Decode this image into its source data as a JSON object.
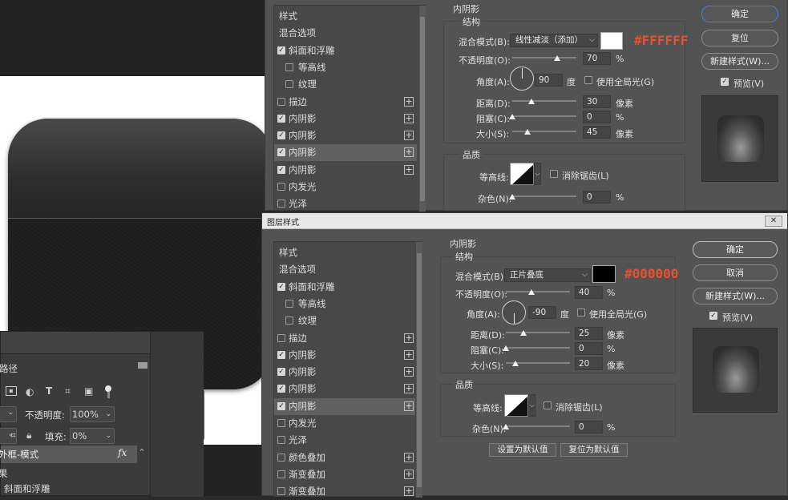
{
  "layers_panel": {
    "tab_label": "路径",
    "opacity_label": "不透明度:",
    "opacity_value": "100%",
    "fill_label": "填充:",
    "fill_value": "0%",
    "layer_name": "外框-模式",
    "fx_label": "fx",
    "effects_label": "果",
    "bevel_label": "斜面和浮雕"
  },
  "dialog_top": {
    "section_title": "内阴影",
    "structure_label": "结构",
    "blend_mode_label": "混合模式(B):",
    "blend_mode_value": "线性减淡（添加）",
    "blend_color": "#FFFFFF",
    "color_annotation": "#FFFFFF",
    "opacity_label": "不透明度(O):",
    "opacity_value": "70",
    "angle_label": "角度(A):",
    "angle_value": "90",
    "degree_unit": "度",
    "global_light_label": "使用全局光(G)",
    "distance_label": "距离(D):",
    "distance_value": "30",
    "choke_label": "阻塞(C):",
    "choke_value": "0",
    "size_label": "大小(S):",
    "size_value": "45",
    "pixel_unit": "像素",
    "percent_unit": "%",
    "quality_label": "品质",
    "contour_label": "等高线:",
    "anti_alias_label": "消除锯齿(L)",
    "noise_label": "杂色(N):",
    "noise_value": "0",
    "ok_label": "确定",
    "reset_label": "复位",
    "new_style_label": "新建样式(W)...",
    "preview_label": "预览(V)"
  },
  "dialog_bottom": {
    "window_title": "图层样式",
    "section_title": "内阴影",
    "structure_label": "结构",
    "blend_mode_label": "混合模式(B):",
    "blend_mode_value": "正片叠底",
    "blend_color": "#000000",
    "color_annotation": "#000000",
    "opacity_label": "不透明度(O):",
    "opacity_value": "40",
    "angle_label": "角度(A):",
    "angle_value": "-90",
    "degree_unit": "度",
    "global_light_label": "使用全局光(G)",
    "distance_label": "距离(D):",
    "distance_value": "25",
    "choke_label": "阻塞(C):",
    "choke_value": "0",
    "size_label": "大小(S):",
    "size_value": "20",
    "pixel_unit": "像素",
    "percent_unit": "%",
    "quality_label": "品质",
    "contour_label": "等高线:",
    "anti_alias_label": "消除锯齿(L)",
    "noise_label": "杂色(N):",
    "noise_value": "0",
    "set_default_label": "设置为默认值",
    "reset_default_label": "复位为默认值",
    "ok_label": "确定",
    "cancel_label": "取消",
    "new_style_label": "新建样式(W)...",
    "preview_label": "预览(V)"
  },
  "style_list_top": [
    {
      "label": "样式",
      "check": null,
      "plus": false,
      "sub": false,
      "hl": false
    },
    {
      "label": "混合选项",
      "check": null,
      "plus": false,
      "sub": false,
      "hl": false
    },
    {
      "label": "斜面和浮雕",
      "check": true,
      "plus": false,
      "sub": false,
      "hl": false
    },
    {
      "label": "等高线",
      "check": false,
      "plus": false,
      "sub": true,
      "hl": false
    },
    {
      "label": "纹理",
      "check": false,
      "plus": false,
      "sub": true,
      "hl": false
    },
    {
      "label": "描边",
      "check": false,
      "plus": true,
      "sub": false,
      "hl": false
    },
    {
      "label": "内阴影",
      "check": true,
      "plus": true,
      "sub": false,
      "hl": false
    },
    {
      "label": "内阴影",
      "check": true,
      "plus": true,
      "sub": false,
      "hl": false
    },
    {
      "label": "内阴影",
      "check": true,
      "plus": true,
      "sub": false,
      "hl": true
    },
    {
      "label": "内阴影",
      "check": true,
      "plus": true,
      "sub": false,
      "hl": false
    },
    {
      "label": "内发光",
      "check": false,
      "plus": false,
      "sub": false,
      "hl": false
    },
    {
      "label": "光泽",
      "check": false,
      "plus": false,
      "sub": false,
      "hl": false
    }
  ],
  "style_list_bottom": [
    {
      "label": "样式",
      "check": null,
      "plus": false,
      "sub": false,
      "hl": false
    },
    {
      "label": "混合选项",
      "check": null,
      "plus": false,
      "sub": false,
      "hl": false
    },
    {
      "label": "斜面和浮雕",
      "check": true,
      "plus": false,
      "sub": false,
      "hl": false
    },
    {
      "label": "等高线",
      "check": false,
      "plus": false,
      "sub": true,
      "hl": false
    },
    {
      "label": "纹理",
      "check": false,
      "plus": false,
      "sub": true,
      "hl": false
    },
    {
      "label": "描边",
      "check": false,
      "plus": true,
      "sub": false,
      "hl": false
    },
    {
      "label": "内阴影",
      "check": true,
      "plus": true,
      "sub": false,
      "hl": false
    },
    {
      "label": "内阴影",
      "check": true,
      "plus": true,
      "sub": false,
      "hl": false
    },
    {
      "label": "内阴影",
      "check": true,
      "plus": true,
      "sub": false,
      "hl": false
    },
    {
      "label": "内阴影",
      "check": true,
      "plus": true,
      "sub": false,
      "hl": true
    },
    {
      "label": "内发光",
      "check": false,
      "plus": false,
      "sub": false,
      "hl": false
    },
    {
      "label": "光泽",
      "check": false,
      "plus": false,
      "sub": false,
      "hl": false
    },
    {
      "label": "颜色叠加",
      "check": false,
      "plus": true,
      "sub": false,
      "hl": false
    },
    {
      "label": "渐变叠加",
      "check": false,
      "plus": true,
      "sub": false,
      "hl": false
    },
    {
      "label": "渐变叠加",
      "check": false,
      "plus": true,
      "sub": false,
      "hl": false
    }
  ]
}
